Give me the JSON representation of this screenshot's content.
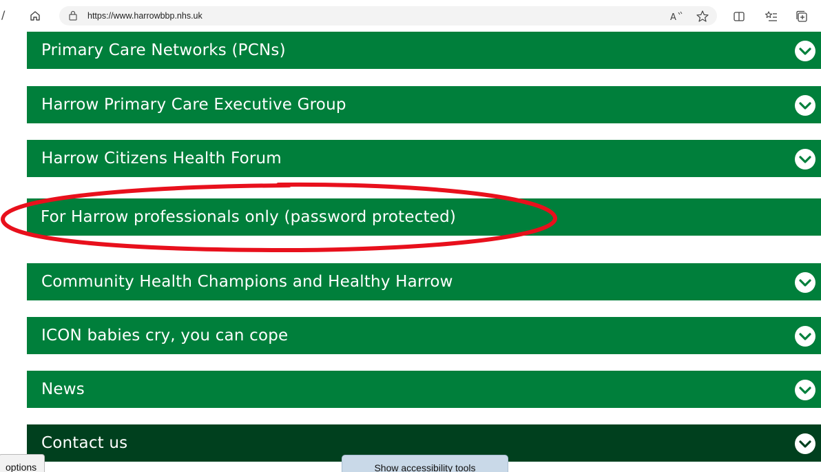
{
  "browser": {
    "url": "https://www.harrowbbp.nhs.uk",
    "left_edge_glyph": "/",
    "icons": [
      "home-icon",
      "lock-icon",
      "read-aloud-icon",
      "favorite-star-icon",
      "split-screen-icon",
      "favorites-list-icon",
      "collections-icon"
    ]
  },
  "accordion": {
    "items": [
      {
        "label": "Primary Care Networks (PCNs)",
        "has_chevron": true
      },
      {
        "label": "Harrow Primary Care Executive Group",
        "has_chevron": true
      },
      {
        "label": "Harrow Citizens Health Forum",
        "has_chevron": true
      },
      {
        "label": "For Harrow professionals only (password protected)",
        "has_chevron": false
      },
      {
        "label": "Community Health Champions and Healthy Harrow",
        "has_chevron": true
      },
      {
        "label": "ICON babies cry, you can cope",
        "has_chevron": true
      },
      {
        "label": "News",
        "has_chevron": true
      },
      {
        "label": "Contact us",
        "has_chevron": true
      }
    ]
  },
  "footer": {
    "options_label": "options",
    "accessibility_label": "Show accessibility tools"
  },
  "colors": {
    "nhs_green": "#007f3b",
    "nhs_dark_green": "#00401e",
    "annotation_red": "#e8101c"
  }
}
